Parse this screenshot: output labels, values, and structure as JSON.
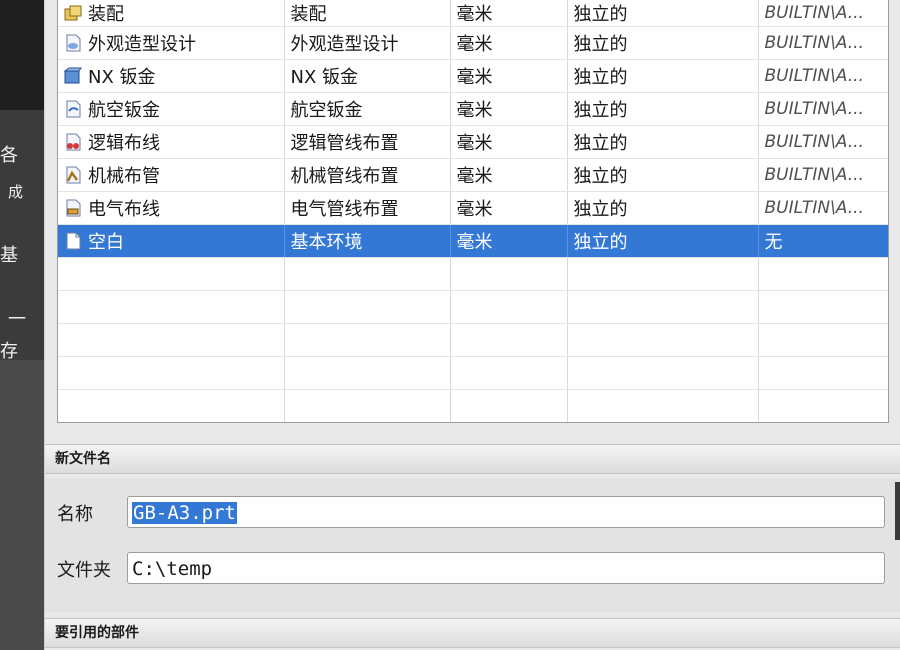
{
  "background_window": {
    "chars": [
      "各",
      "成",
      "基",
      "一",
      "存"
    ]
  },
  "table": {
    "rows": [
      {
        "icon": "assembly-icon",
        "name": "装配",
        "type": "装配",
        "unit": "毫米",
        "relation": "独立的",
        "owner": "BUILTIN\\A...",
        "owner_italic": true
      },
      {
        "icon": "shape-studio-icon",
        "name": "外观造型设计",
        "type": "外观造型设计",
        "unit": "毫米",
        "relation": "独立的",
        "owner": "BUILTIN\\A...",
        "owner_italic": true
      },
      {
        "icon": "nx-sheet-metal-icon",
        "name": "NX 钣金",
        "type": "NX 钣金",
        "unit": "毫米",
        "relation": "独立的",
        "owner": "BUILTIN\\A...",
        "owner_italic": true
      },
      {
        "icon": "aero-sheet-metal-icon",
        "name": "航空钣金",
        "type": "航空钣金",
        "unit": "毫米",
        "relation": "独立的",
        "owner": "BUILTIN\\A...",
        "owner_italic": true
      },
      {
        "icon": "logical-routing-icon",
        "name": "逻辑布线",
        "type": "逻辑管线布置",
        "unit": "毫米",
        "relation": "独立的",
        "owner": "BUILTIN\\A...",
        "owner_italic": true
      },
      {
        "icon": "mechanical-routing-icon",
        "name": "机械布管",
        "type": "机械管线布置",
        "unit": "毫米",
        "relation": "独立的",
        "owner": "BUILTIN\\A...",
        "owner_italic": true
      },
      {
        "icon": "electrical-routing-icon",
        "name": "电气布线",
        "type": "电气管线布置",
        "unit": "毫米",
        "relation": "独立的",
        "owner": "BUILTIN\\A...",
        "owner_italic": true
      },
      {
        "icon": "blank-document-icon",
        "name": "空白",
        "type": "基本环境",
        "unit": "毫米",
        "relation": "独立的",
        "owner": "无",
        "owner_italic": false,
        "selected": true
      }
    ]
  },
  "new_file": {
    "header": "新文件名",
    "name_label": "名称",
    "name_value": "GB-A3.prt",
    "folder_label": "文件夹",
    "folder_value": "C:\\temp"
  },
  "referenced_part": {
    "header": "要引用的部件"
  },
  "colors": {
    "selection": "#3478d6",
    "background": "#e9e9e9"
  }
}
